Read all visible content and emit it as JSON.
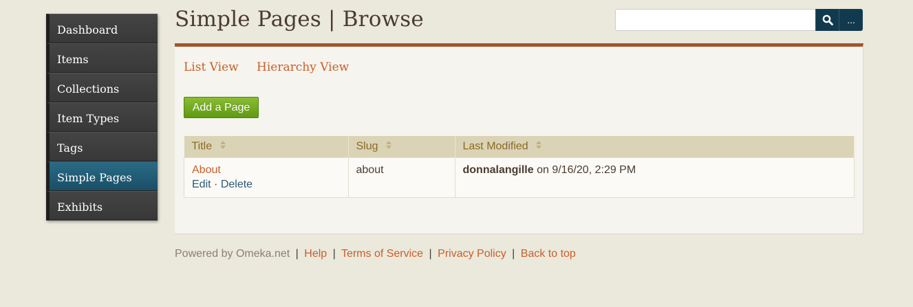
{
  "sidebar": {
    "items": [
      {
        "label": "Dashboard"
      },
      {
        "label": "Items"
      },
      {
        "label": "Collections"
      },
      {
        "label": "Item Types"
      },
      {
        "label": "Tags"
      },
      {
        "label": "Simple Pages"
      },
      {
        "label": "Exhibits"
      }
    ],
    "active_item": "Simple Pages"
  },
  "header": {
    "title": "Simple Pages | Browse",
    "search_placeholder": "",
    "search_icon": "search-icon",
    "advanced_search_label": "..."
  },
  "tabs": [
    {
      "label": "List View"
    },
    {
      "label": "Hierarchy View"
    }
  ],
  "add_page_label": "Add a Page",
  "table": {
    "columns": [
      "Title",
      "Slug",
      "Last Modified"
    ],
    "rows": [
      {
        "title": "About",
        "edit_label": "Edit",
        "separator": "·",
        "delete_label": "Delete",
        "slug": "about",
        "modified_by": "donnalangille",
        "modified_on": "on 9/16/20, 2:29 PM"
      }
    ]
  },
  "footer": {
    "powered_by": "Powered by Omeka.net",
    "links": [
      "Help",
      "Terms of Service",
      "Privacy Policy",
      "Back to top"
    ],
    "separator": "|"
  },
  "colors": {
    "accent_orange": "#c75f2b",
    "nav_active": "#1f5a73",
    "add_button_green": "#6fa91c",
    "panel_border": "#a4532f"
  }
}
